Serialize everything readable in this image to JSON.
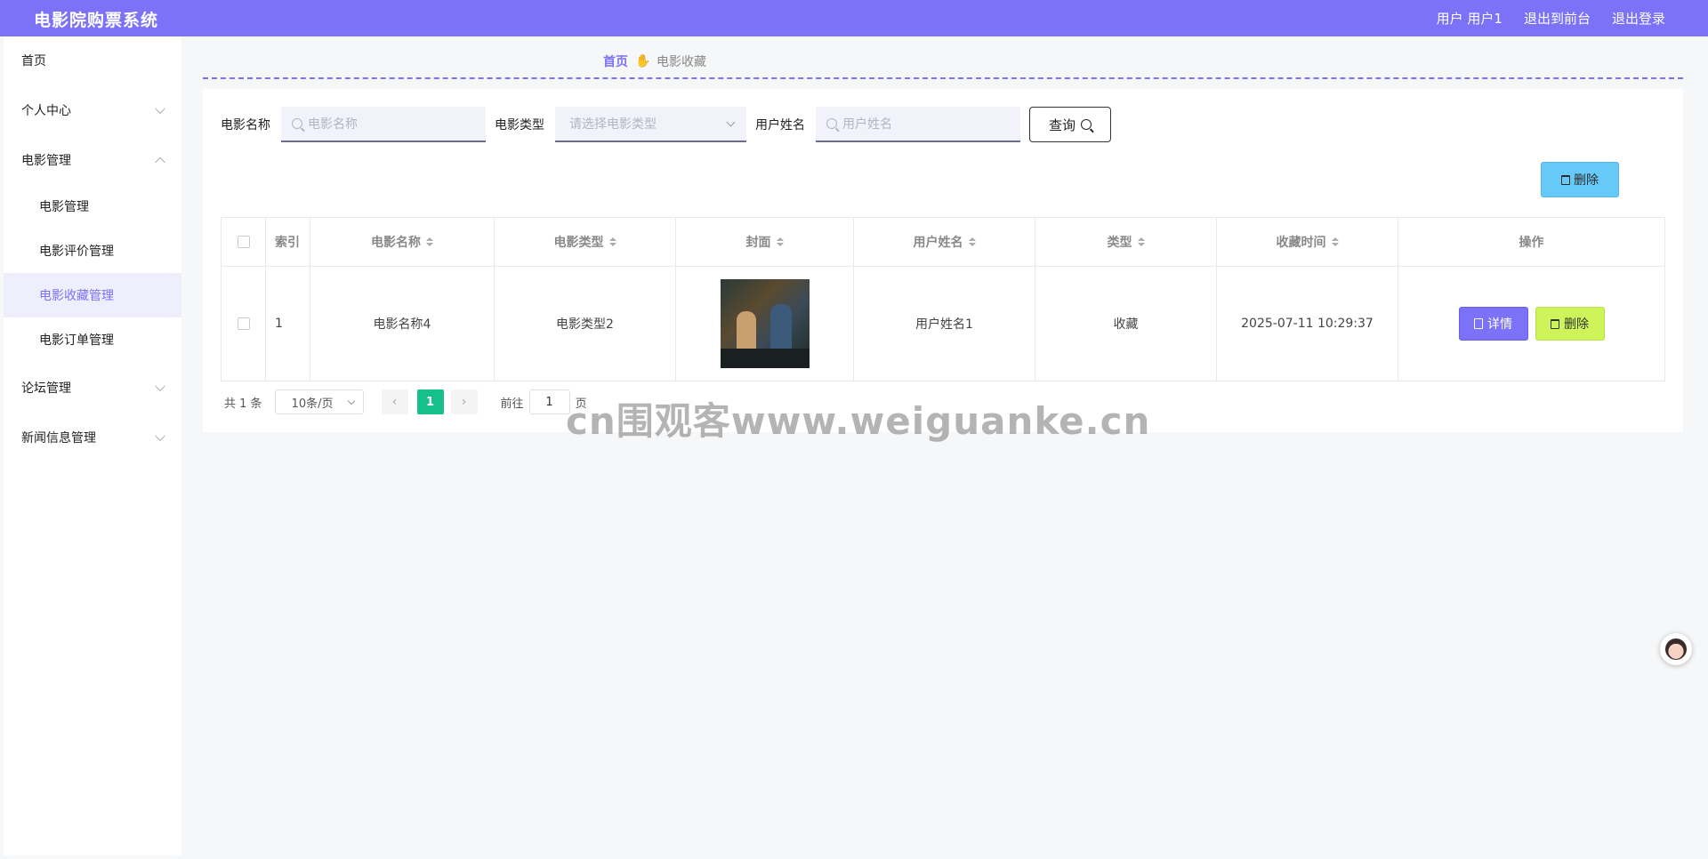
{
  "header": {
    "brand": "电影院购票系统",
    "user_label": "用户 用户1",
    "back_to_front": "退出到前台",
    "logout": "退出登录"
  },
  "sidebar": {
    "home": "首页",
    "personal_center": "个人中心",
    "movie_mgmt_group": "电影管理",
    "sub_items": [
      "电影管理",
      "电影评价管理",
      "电影收藏管理",
      "电影订单管理"
    ],
    "active_sub": "电影收藏管理",
    "forum_mgmt": "论坛管理",
    "news_mgmt": "新闻信息管理"
  },
  "breadcrumb": {
    "home": "首页",
    "separator_icon": "hand-pointer-icon",
    "current": "电影收藏"
  },
  "search": {
    "movie_name_label": "电影名称",
    "movie_name_placeholder": "电影名称",
    "movie_type_label": "电影类型",
    "movie_type_placeholder": "请选择电影类型",
    "user_name_label": "用户姓名",
    "user_name_placeholder": "用户姓名",
    "query_button": "查询"
  },
  "actions": {
    "batch_delete": "删除"
  },
  "table": {
    "headers": [
      "索引",
      "电影名称",
      "电影类型",
      "封面",
      "用户姓名",
      "类型",
      "收藏时间",
      "操作"
    ],
    "rows": [
      {
        "index": "1",
        "movie_name": "电影名称4",
        "movie_type": "电影类型2",
        "user_name": "用户姓名1",
        "type": "收藏",
        "collect_time": "2025-07-11 10:29:37",
        "detail_button": "详情",
        "delete_button": "删除"
      }
    ]
  },
  "pagination": {
    "total": "共 1 条",
    "page_size": "10条/页",
    "current_page": "1",
    "goto_label": "前往",
    "goto_value": "1",
    "page_suffix": "页"
  },
  "watermark": "cn围观客www.weiguanke.cn",
  "colors": {
    "header": "#7b72f8",
    "accent": "#7b72f8",
    "batch_delete": "#66c9f8",
    "row_delete": "#cdf55a",
    "active_page": "#16c08a"
  }
}
